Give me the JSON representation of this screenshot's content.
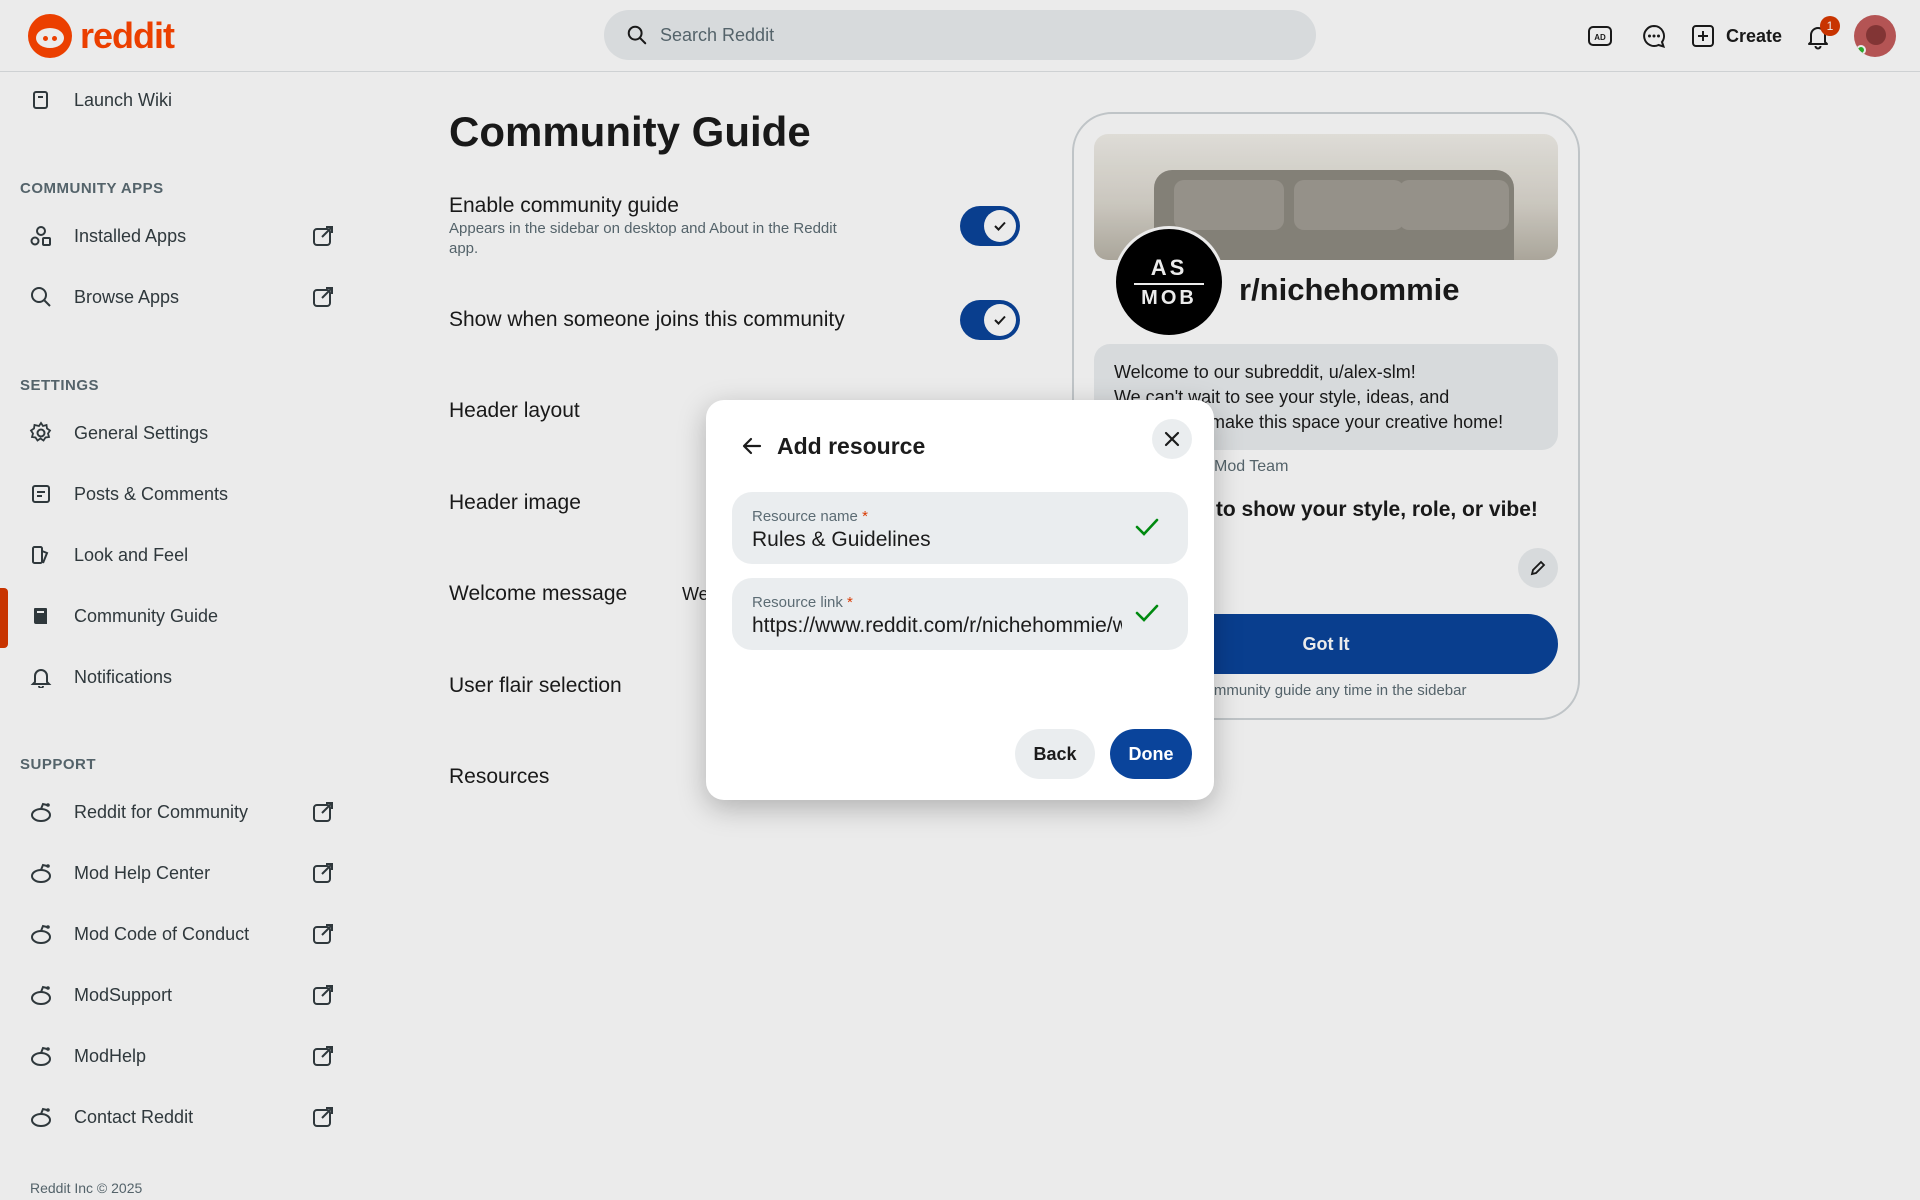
{
  "header": {
    "logo_text": "reddit",
    "search_placeholder": "Search Reddit",
    "create_label": "Create",
    "notification_count": "1"
  },
  "sidebar": {
    "top_item": "Launch Wiki",
    "community_apps_heading": "COMMUNITY APPS",
    "apps": [
      "Installed Apps",
      "Browse Apps"
    ],
    "settings_heading": "SETTINGS",
    "settings": [
      "General Settings",
      "Posts & Comments",
      "Look and Feel",
      "Community Guide",
      "Notifications"
    ],
    "active_item": "Community Guide",
    "support_heading": "SUPPORT",
    "support": [
      "Reddit for Community",
      "Mod Help Center",
      "Mod Code of Conduct",
      "ModSupport",
      "ModHelp",
      "Contact Reddit"
    ],
    "footer": "Reddit Inc © 2025"
  },
  "main": {
    "title": "Community Guide",
    "enable_label": "Enable community guide",
    "enable_sub": "Appears in the sidebar on desktop and About in the Reddit app.",
    "enable_on": true,
    "show_join_label": "Show when someone joins this community",
    "show_join_on": true,
    "header_layout_label": "Header layout",
    "header_image_label": "Header image",
    "welcome_message_label": "Welcome message",
    "welcome_preview": "We",
    "user_flair_label": "User flair selection",
    "resources_label": "Resources"
  },
  "preview": {
    "community_name": "r/nichehommie",
    "avatar_top": "AS",
    "avatar_bottom": "MOB",
    "welcome_line1": "Welcome to our subreddit, u/alex-slm!",
    "welcome_line2": "We can't wait to see your style, ideas, and",
    "welcome_line3": "make this space your creative home!",
    "mod_team": "Mod Team",
    "flair_prompt": "ir to show your style, role, or vibe!",
    "got_it": "Got It",
    "view_guide": "e community guide any time in the sidebar"
  },
  "modal": {
    "title": "Add resource",
    "name_label": "Resource name",
    "name_value": "Rules & Guidelines",
    "link_label": "Resource link",
    "link_value": "https://www.reddit.com/r/nichehommie/w",
    "required_mark": "*",
    "back_label": "Back",
    "done_label": "Done"
  },
  "colors": {
    "brand": "#ff4500",
    "primary_button": "#0a449b",
    "active_indicator": "#d93900",
    "valid_check": "#008a10",
    "field_bg": "#eaedef"
  }
}
